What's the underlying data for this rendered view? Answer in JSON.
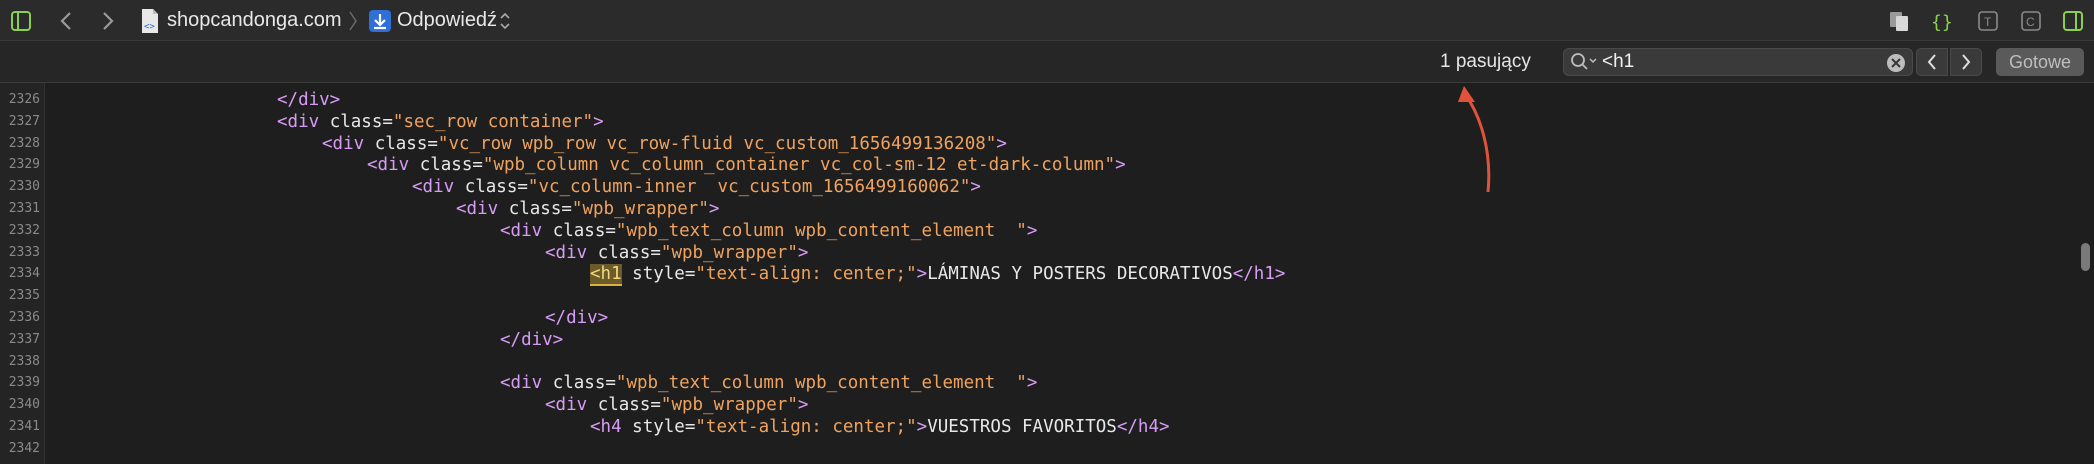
{
  "toolbar": {
    "site": "shopcandonga.com",
    "resource": "Odpowiedź"
  },
  "find": {
    "match_count": "1 pasujący",
    "query": "<h1",
    "done_label": "Gotowe"
  },
  "code": {
    "lines": [
      {
        "num": "2326",
        "parts": [
          [
            "tag",
            "</div>"
          ]
        ]
      },
      {
        "num": "2327",
        "parts": [
          [
            "tag",
            "<div "
          ],
          [
            "attr",
            "class="
          ],
          [
            "val",
            "\"sec_row container\""
          ],
          [
            "tag",
            ">"
          ]
        ]
      },
      {
        "num": "2328",
        "parts": [
          [
            "tag",
            "<div "
          ],
          [
            "attr",
            "class="
          ],
          [
            "val",
            "\"vc_row wpb_row vc_row-fluid vc_custom_1656499136208\""
          ],
          [
            "tag",
            ">"
          ]
        ]
      },
      {
        "num": "2329",
        "parts": [
          [
            "tag",
            "<div "
          ],
          [
            "attr",
            "class="
          ],
          [
            "val",
            "\"wpb_column vc_column_container vc_col-sm-12 et-dark-column\""
          ],
          [
            "tag",
            ">"
          ]
        ]
      },
      {
        "num": "2330",
        "parts": [
          [
            "tag",
            "<div "
          ],
          [
            "attr",
            "class="
          ],
          [
            "val",
            "\"vc_column-inner  vc_custom_1656499160062\""
          ],
          [
            "tag",
            ">"
          ]
        ]
      },
      {
        "num": "2331",
        "parts": [
          [
            "tag",
            "<div "
          ],
          [
            "attr",
            "class="
          ],
          [
            "val",
            "\"wpb_wrapper\""
          ],
          [
            "tag",
            ">"
          ]
        ]
      },
      {
        "num": "2332",
        "parts": [
          [
            "tag",
            "<div "
          ],
          [
            "attr",
            "class="
          ],
          [
            "val",
            "\"wpb_text_column wpb_content_element  \""
          ],
          [
            "tag",
            ">"
          ]
        ]
      },
      {
        "num": "2333",
        "parts": [
          [
            "tag",
            "<div "
          ],
          [
            "attr",
            "class="
          ],
          [
            "val",
            "\"wpb_wrapper\""
          ],
          [
            "tag",
            ">"
          ]
        ]
      },
      {
        "num": "2334",
        "parts": [
          [
            "hl",
            "<h1"
          ],
          [
            "tag",
            " "
          ],
          [
            "attr",
            "style="
          ],
          [
            "val",
            "\"text-align: center;\""
          ],
          [
            "tag",
            ">"
          ],
          [
            "txt",
            "LÁMINAS Y POSTERS DECORATIVOS"
          ],
          [
            "tag",
            "</h1>"
          ]
        ]
      },
      {
        "num": "2335",
        "parts": []
      },
      {
        "num": "2336",
        "parts": [
          [
            "tag",
            "</div>"
          ]
        ]
      },
      {
        "num": "2337",
        "parts": [
          [
            "tag",
            "</div>"
          ]
        ]
      },
      {
        "num": "2338",
        "parts": []
      },
      {
        "num": "2339",
        "parts": [
          [
            "tag",
            "<div "
          ],
          [
            "attr",
            "class="
          ],
          [
            "val",
            "\"wpb_text_column wpb_content_element  \""
          ],
          [
            "tag",
            ">"
          ]
        ]
      },
      {
        "num": "2340",
        "parts": [
          [
            "tag",
            "<div "
          ],
          [
            "attr",
            "class="
          ],
          [
            "val",
            "\"wpb_wrapper\""
          ],
          [
            "tag",
            ">"
          ]
        ]
      },
      {
        "num": "2341",
        "parts": [
          [
            "tag",
            "<h4 "
          ],
          [
            "attr",
            "style="
          ],
          [
            "val",
            "\"text-align: center;\""
          ],
          [
            "tag",
            ">"
          ],
          [
            "txt",
            "VUESTROS FAVORITOS"
          ],
          [
            "tag",
            "</h4>"
          ]
        ]
      },
      {
        "num": "2342",
        "parts": []
      }
    ]
  },
  "icons": {
    "sidebar": "sidebar-toggle-icon",
    "back": "chevron-left-icon",
    "forward": "chevron-right-icon",
    "file": "file-code-icon",
    "download": "download-icon",
    "updown": "chevron-updown-icon",
    "copy": "copy-icon",
    "braces": "braces-icon",
    "t": "t-box-icon",
    "c": "c-box-icon",
    "sidebar_right": "sidebar-right-icon",
    "search": "magnifier-icon",
    "clear": "clear-icon",
    "prev": "previous-match-icon",
    "next": "next-match-icon"
  },
  "colors": {
    "accent_green": "#8ad14c",
    "tag": "#d89cf6",
    "value": "#f0a35e",
    "arrow": "#e0523a"
  }
}
